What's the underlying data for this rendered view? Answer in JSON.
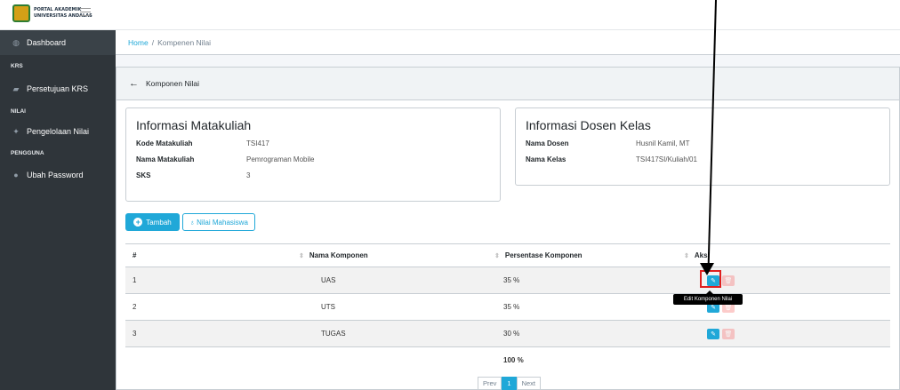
{
  "brand": {
    "line1": "PORTAL AKADEMIK",
    "line2": "UNIVERSITAS ANDALAS",
    "logo_icon": "university-logo-icon"
  },
  "sidebar": {
    "items": [
      {
        "label": "Dashboard",
        "icon": "dashboard-icon"
      },
      {
        "label": "Persetujuan KRS",
        "icon": "approve-icon"
      },
      {
        "label": "Pengelolaan Nilai",
        "icon": "grades-icon"
      },
      {
        "label": "Ubah Password",
        "icon": "lock-icon"
      }
    ],
    "sections": [
      "KRS",
      "NILAI",
      "PENGGUNA"
    ]
  },
  "breadcrumb": {
    "home": "Home",
    "separator": "/",
    "current": "Kompenen Nilai"
  },
  "card": {
    "header": "Komponen Nilai"
  },
  "info_matakuliah": {
    "title": "Informasi Matakuliah",
    "rows": [
      {
        "k": "Kode Matakuliah",
        "v": "TSI417"
      },
      {
        "k": "Nama Matakuliah",
        "v": "Pemrograman Mobile"
      },
      {
        "k": "SKS",
        "v": "3"
      }
    ]
  },
  "info_dosen": {
    "title": "Informasi Dosen Kelas",
    "rows": [
      {
        "k": "Nama Dosen",
        "v": "Husnil Kamil, MT"
      },
      {
        "k": "Nama Kelas",
        "v": "TSI417SI/Kuliah/01"
      }
    ]
  },
  "buttons": {
    "tambah": "Tambah",
    "nilai_mahasiswa": "Nilai Mahasiswa"
  },
  "table": {
    "headers": [
      "#",
      "Nama Komponen",
      "Persentase Komponen",
      "Aksi"
    ],
    "rows": [
      {
        "no": "1",
        "nama": "UAS",
        "persen": "35 %"
      },
      {
        "no": "2",
        "nama": "UTS",
        "persen": "35 %"
      },
      {
        "no": "3",
        "nama": "TUGAS",
        "persen": "30 %"
      }
    ],
    "total": "100 %"
  },
  "tooltip": "Edit Komponen Nilai",
  "pagination": {
    "prev": "Prev",
    "current": "1",
    "next": "Next"
  },
  "colors": {
    "primary": "#20a8d8",
    "sidebar": "#2f353a",
    "danger": "#f86c6b",
    "highlight": "#e02020"
  }
}
